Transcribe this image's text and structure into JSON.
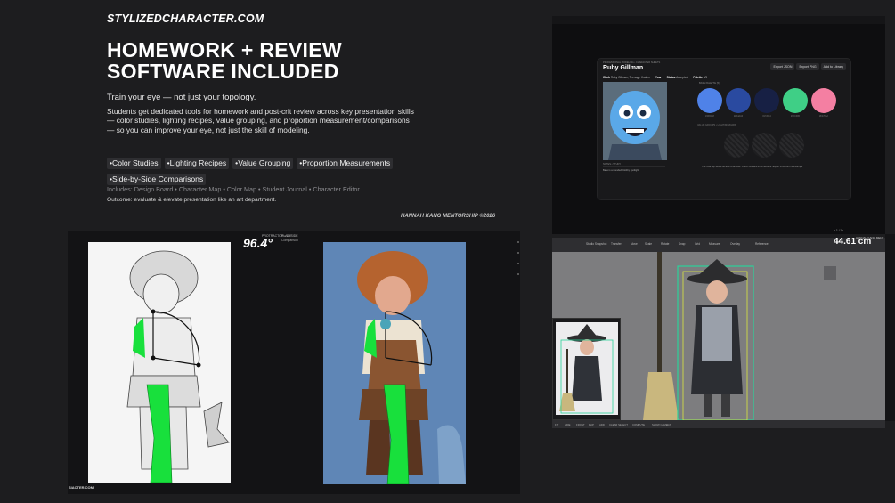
{
  "brand": "STYLIZEDCHARACTER.COM",
  "headline": {
    "line1": "HOMEWORK + REVIEW",
    "line2": "SOFTWARE INCLUDED"
  },
  "tagline": "Train your eye — not just your topology.",
  "description": "Students get dedicated tools for homework and post-crit review across key presentation skills — color studies, lighting recipes, value grouping, and proportion measurement/comparisons — so you can improve your eye, not just the skill of modeling.",
  "chips": [
    "Color Studies",
    "Lighting Recipes",
    "Value Grouping",
    "Proportion Measurements",
    "Side-by-Side Comparisons"
  ],
  "includes": "Includes: Design Board • Character Map • Color Map • Student Journal • Character Editor",
  "outcome": "Outcome: evaluate & elevate presentation like an art department.",
  "credit": "HANNAH KANG MENTORSHIP ©2026",
  "protractor": {
    "label": "PROTRACTOR • 15 SIDE",
    "value": "96.4°",
    "side_label": "PLACE",
    "side_label2": "Comparison"
  },
  "watermark": "SIACTER.COM",
  "library_card": {
    "small_label": "PROFESSIONAL MODELING • CHARACTER SHEETS",
    "title": "Ruby Gillman",
    "buttons": [
      "Export JSON",
      "Export PNG",
      "Add to Library"
    ],
    "meta": [
      {
        "key": "Work",
        "value": "Ruby Gillman, Teenage Kraken"
      },
      {
        "key": "Year",
        "value": ""
      },
      {
        "key": "Status",
        "value": "Accepted"
      },
      {
        "key": "Palette",
        "value": "5/5"
      }
    ],
    "palette_label": "BASE PALETTE (5)",
    "swatches": [
      {
        "color": "#4f82e8",
        "label": "#4F82E8"
      },
      {
        "color": "#2a4aa0",
        "label": "#2A4AA0"
      },
      {
        "color": "#172044",
        "label": "#172044"
      },
      {
        "color": "#3fcf86",
        "label": "#3FCF86"
      },
      {
        "color": "#f47fa2",
        "label": "#F47FA2"
      }
    ],
    "value_label": "VALUE GROUPS • LIGHT/MID/DARK",
    "notes_label": "NOTES • STUDY",
    "notes_text": "Base is a rounded, blobby spotlight",
    "note_right": "The Ollie rep would be able to access. OSDO first and a fair amount. Export PNG the PNGnstrings",
    "page": "‹ 1 / 1 ›"
  },
  "viewport": {
    "measure": "44.61 cm",
    "measure_sub": "HANNAH KANG MENT",
    "toolbar": [
      "Studio Snapshot",
      "Transfer",
      "Move",
      "Scale",
      "Rotate",
      "Snap",
      "Grid",
      "Measure",
      "Overlay",
      "Reference"
    ],
    "bottom": [
      "FIT",
      "SIDE",
      "FRONT",
      "FLIP",
      "ADD",
      "CLEAR SELECT",
      "COMPUTE",
      "SHOW CAMERA"
    ]
  }
}
